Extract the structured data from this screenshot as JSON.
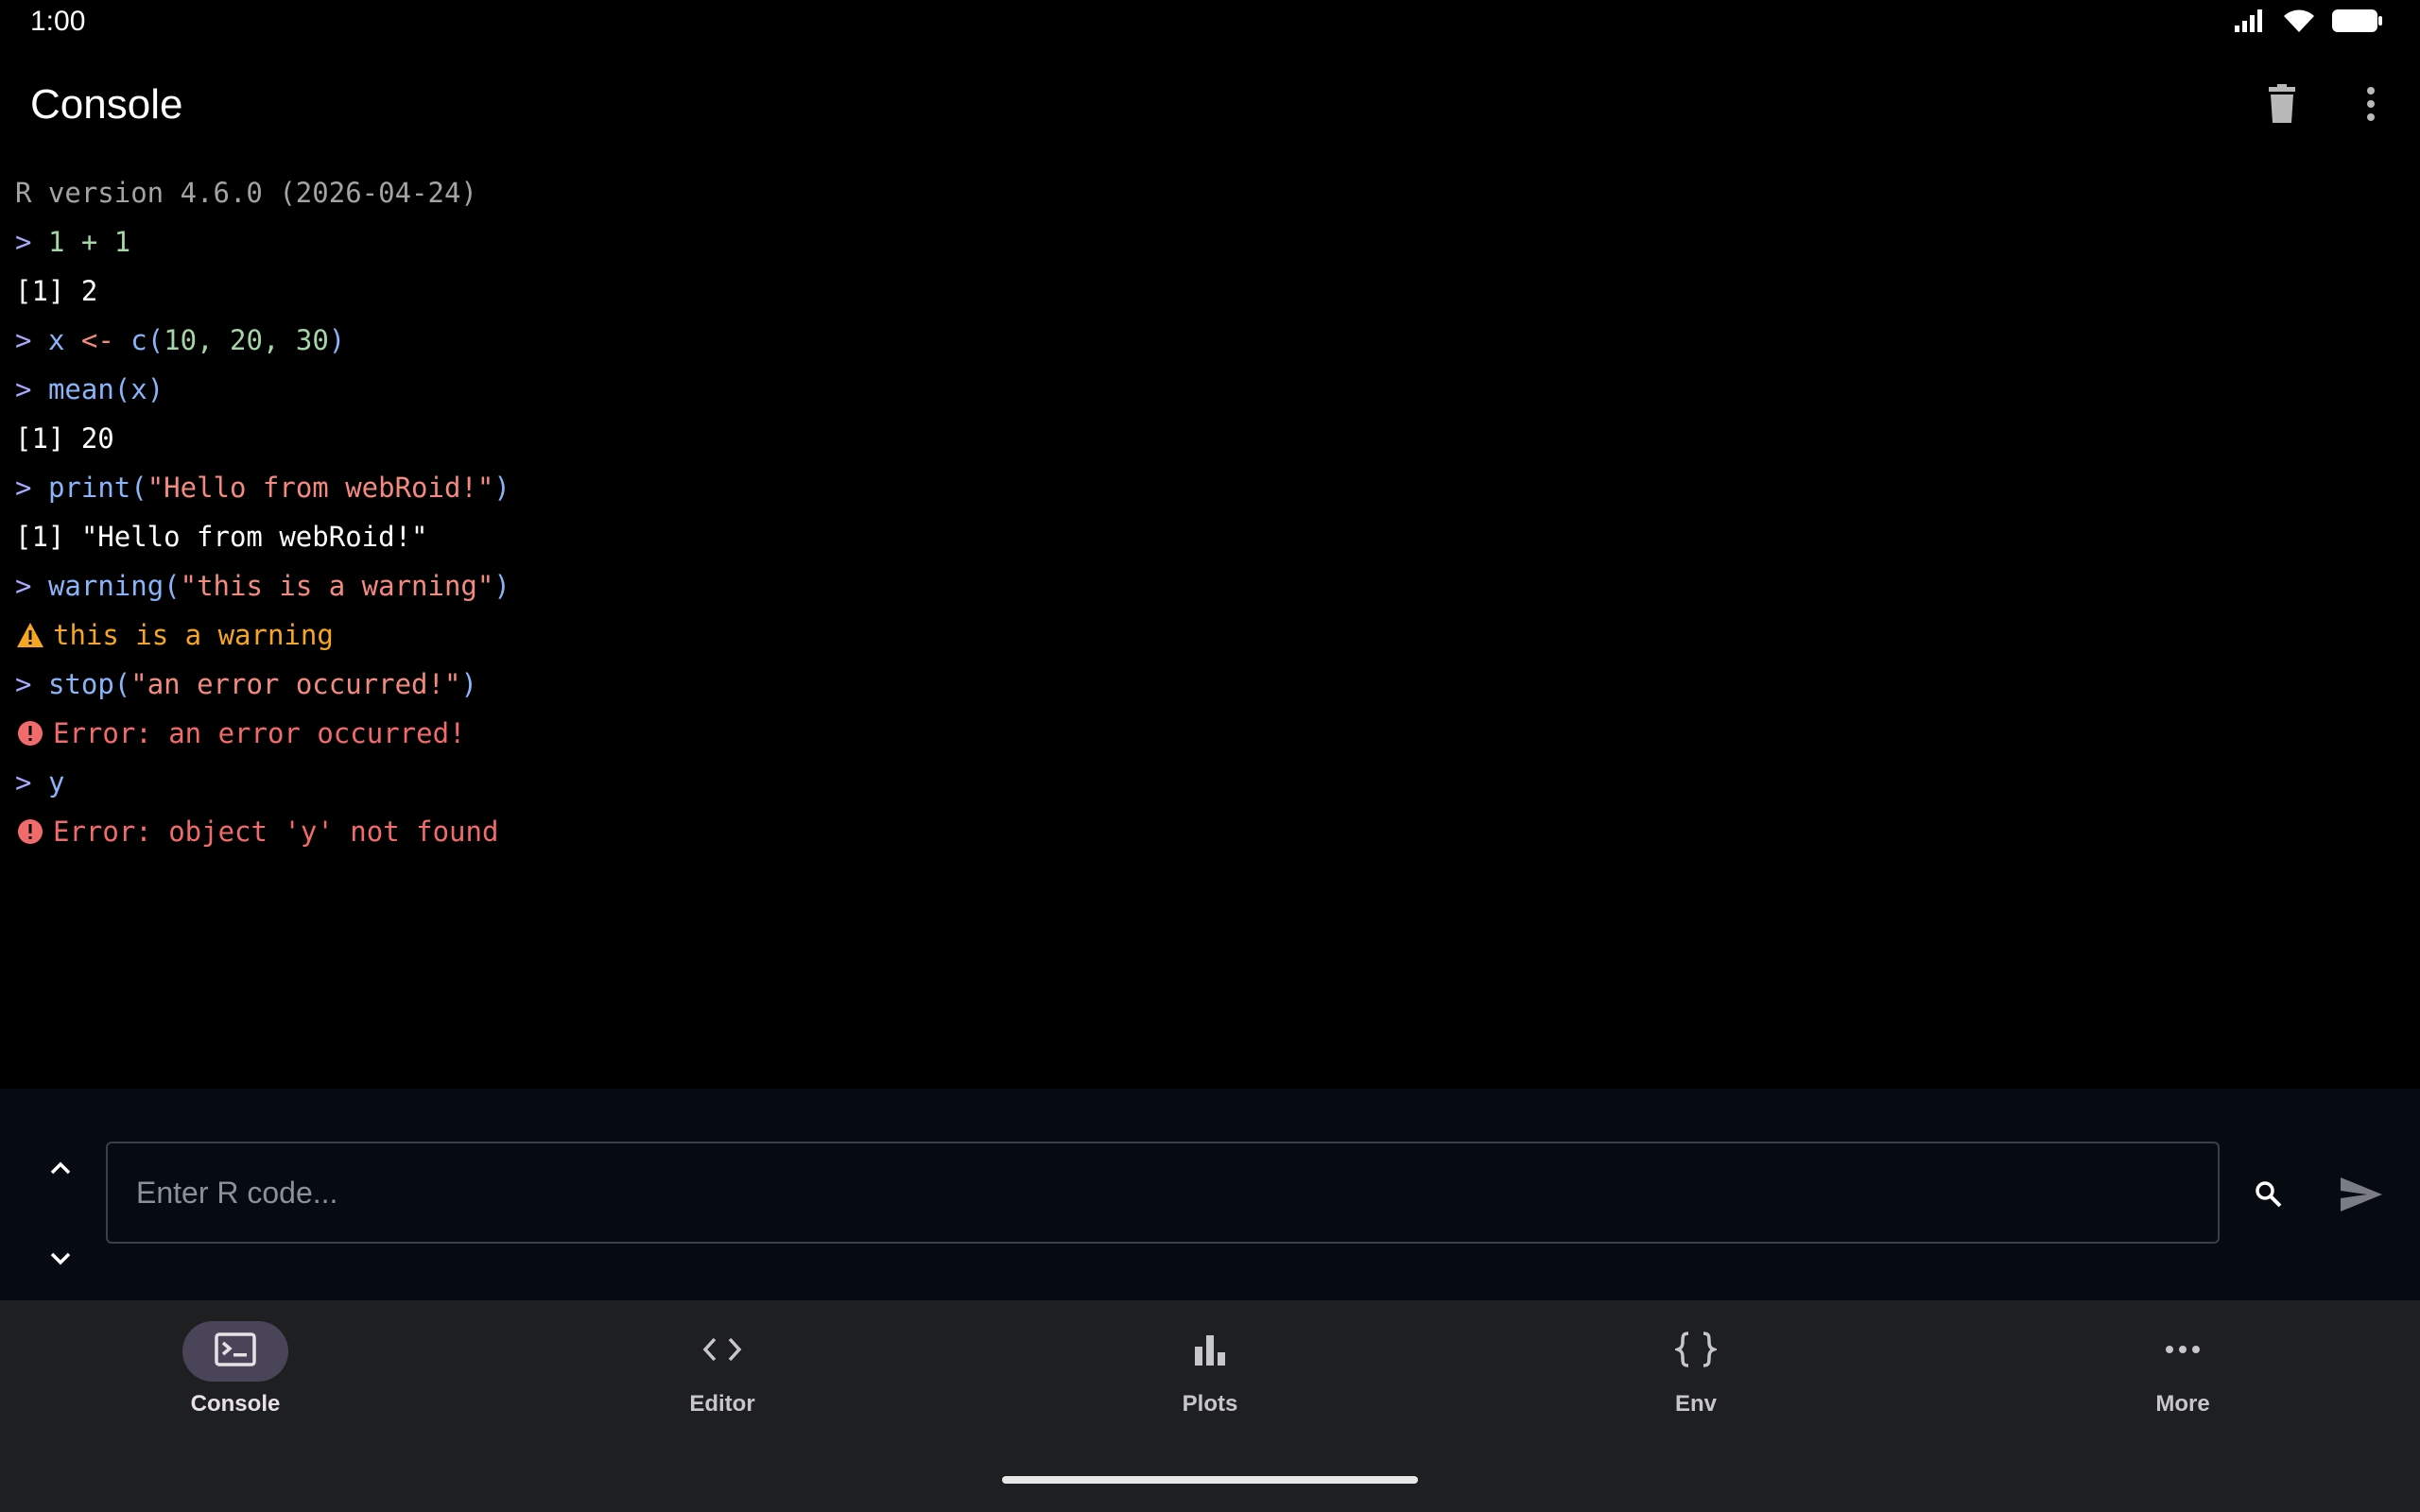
{
  "status_bar": {
    "time": "1:00",
    "icons": [
      "signal-icon",
      "wifi-icon",
      "battery-icon"
    ]
  },
  "app_bar": {
    "title": "Console",
    "actions": [
      "trash-icon",
      "more-vert-icon"
    ]
  },
  "console": {
    "version_line": "R version 4.6.0 (2026-04-24)",
    "prompt_symbol": ">",
    "cmd1": "1 + 1",
    "out1": "[1] 2",
    "cmd2_var": "x",
    "cmd2_op": "<-",
    "cmd2_fn": "c(",
    "cmd2_args": "10, 20, 30",
    "cmd2_close": ")",
    "cmd3": "mean(x)",
    "out3": "[1] 20",
    "cmd4_fn": "print(",
    "cmd4_str": "\"Hello from webRoid!\"",
    "cmd4_close": ")",
    "out4": "[1] \"Hello from webRoid!\"",
    "cmd5_fn": "warning(",
    "cmd5_str": "\"this is a warning\"",
    "cmd5_close": ")",
    "warn5": "this is a warning",
    "cmd6_fn": "stop(",
    "cmd6_str": "\"an error occurred!\"",
    "cmd6_close": ")",
    "err6": "Error: an error occurred!",
    "cmd7": "y",
    "err7": "Error: object 'y' not found"
  },
  "input": {
    "placeholder": "Enter R code..."
  },
  "bottom_nav": {
    "items": [
      {
        "label": "Console",
        "icon": "terminal-icon",
        "active": true
      },
      {
        "label": "Editor",
        "icon": "code-icon",
        "active": false
      },
      {
        "label": "Plots",
        "icon": "bar-chart-icon",
        "active": false
      },
      {
        "label": "Env",
        "icon": "braces-icon",
        "active": false
      },
      {
        "label": "More",
        "icon": "more-horiz-icon",
        "active": false
      }
    ]
  },
  "colors": {
    "background": "#000000",
    "input_area": "#060b12",
    "nav_background": "#1e1f21",
    "active_pill": "#4a4458",
    "prompt": "#a8a8ff",
    "string": "#f48a7f",
    "warning": "#f6a623",
    "error": "#f26b6b",
    "function": "#8ab4f8",
    "number": "#a5d6a7"
  }
}
